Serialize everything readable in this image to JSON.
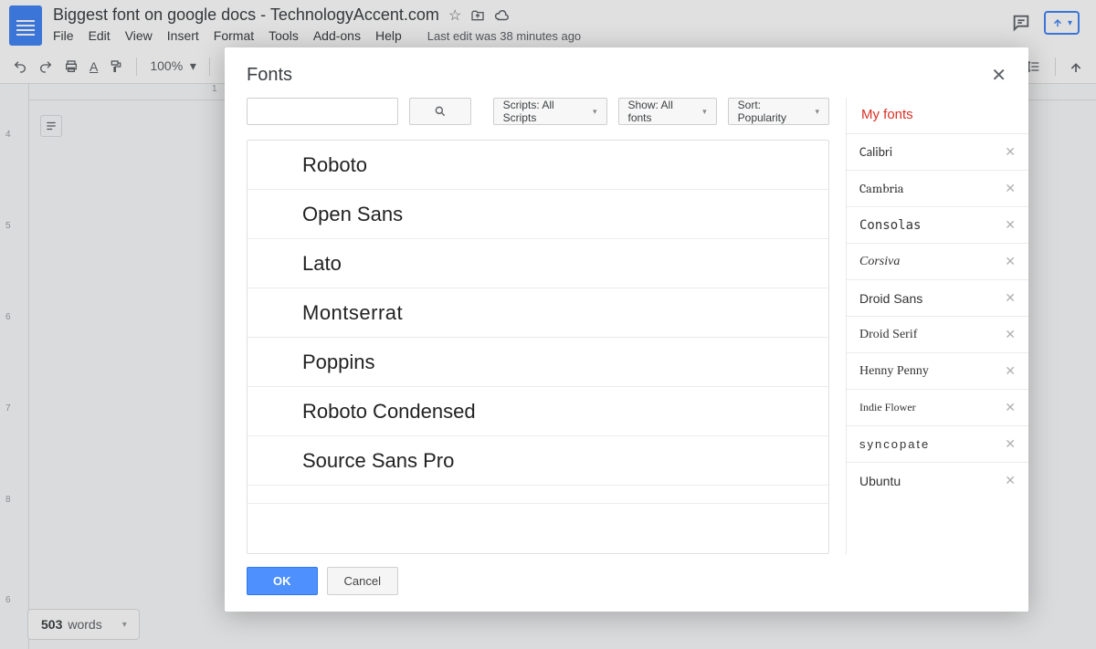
{
  "header": {
    "doc_title": "Biggest font on google docs - TechnologyAccent.com",
    "menus": [
      "File",
      "Edit",
      "View",
      "Insert",
      "Format",
      "Tools",
      "Add-ons",
      "Help"
    ],
    "last_edit": "Last edit was 38 minutes ago"
  },
  "toolbar": {
    "zoom": "100%"
  },
  "ruler_h": {
    "mark": "1"
  },
  "ruler_v": {
    "marks": [
      "4",
      "5",
      "6",
      "7",
      "8",
      "6"
    ]
  },
  "footer": {
    "word_count_num": "503",
    "word_count_label": "words"
  },
  "modal": {
    "title": "Fonts",
    "filters": {
      "scripts": "Scripts: All Scripts",
      "show": "Show: All fonts",
      "sort": "Sort: Popularity"
    },
    "font_list": [
      {
        "name": "Roboto",
        "css": "font-family: Arial, sans-serif; font-weight: 400;"
      },
      {
        "name": "Open Sans",
        "css": "font-family: Arial, sans-serif; font-weight: 400;"
      },
      {
        "name": "Lato",
        "css": "font-family: Arial, sans-serif; font-weight: 400;"
      },
      {
        "name": "Montserrat",
        "css": "font-family: Arial, sans-serif; font-weight: 300; letter-spacing: 0.5px;"
      },
      {
        "name": "Poppins",
        "css": "font-family: Arial, sans-serif; font-weight: 400;"
      },
      {
        "name": "Roboto Condensed",
        "css": "font-family: 'Arial Narrow', Arial, sans-serif; font-weight: 400;"
      },
      {
        "name": "Source Sans Pro",
        "css": "font-family: Arial, sans-serif; font-weight: 400;"
      }
    ],
    "my_fonts_title": "My fonts",
    "my_fonts": [
      {
        "name": "Calibri",
        "css": "font-family: Calibri, Arial, sans-serif;"
      },
      {
        "name": "Cambria",
        "css": "font-family: Cambria, Georgia, serif;"
      },
      {
        "name": "Consolas",
        "css": "font-family: Consolas, monospace;"
      },
      {
        "name": "Corsiva",
        "css": "font-family: 'Monotype Corsiva', cursive; font-style: italic;"
      },
      {
        "name": "Droid Sans",
        "css": "font-family: Arial, sans-serif;"
      },
      {
        "name": "Droid Serif",
        "css": "font-family: Georgia, serif;"
      },
      {
        "name": "Henny Penny",
        "css": "font-family: 'Comic Sans MS', cursive;"
      },
      {
        "name": "Indie Flower",
        "css": "font-family: 'Comic Sans MS', cursive; font-size: 12px;"
      },
      {
        "name": "Syncopate",
        "css": "font-family: Arial, sans-serif; letter-spacing: 2px; text-transform: lowercase; font-size: 13px;"
      },
      {
        "name": "Ubuntu",
        "css": "font-family: Arial, sans-serif;"
      }
    ],
    "buttons": {
      "ok": "OK",
      "cancel": "Cancel"
    }
  }
}
